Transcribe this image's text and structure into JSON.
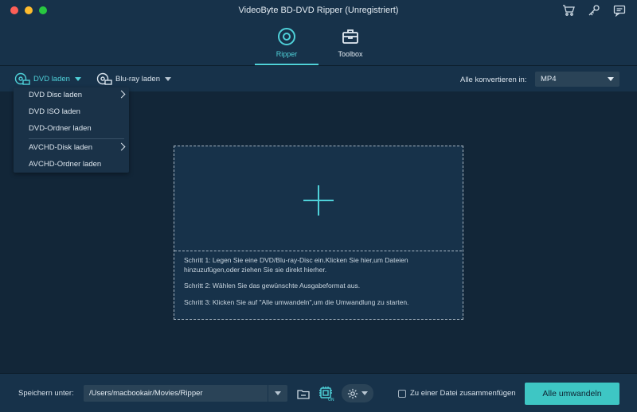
{
  "window": {
    "title": "VideoByte BD-DVD Ripper (Unregistriert)",
    "top_icons": [
      "cart-icon",
      "key-icon",
      "chat-icon"
    ]
  },
  "tabs": [
    {
      "label": "Ripper",
      "icon": "disc-icon",
      "active": true
    },
    {
      "label": "Toolbox",
      "icon": "toolbox-icon",
      "active": false
    }
  ],
  "toolbar": {
    "dvd_label": "DVD laden",
    "bluray_label": "Blu-ray laden",
    "convert_all_to_label": "Alle konvertieren in:",
    "format_value": "MP4"
  },
  "dvd_menu": {
    "items": [
      {
        "label": "DVD Disc laden",
        "submenu": true
      },
      {
        "label": "DVD ISO laden",
        "submenu": false
      },
      {
        "label": "DVD-Ordner laden",
        "submenu": false
      },
      {
        "label": "AVCHD-Disk laden",
        "submenu": true
      },
      {
        "label": "AVCHD-Ordner laden",
        "submenu": false
      }
    ]
  },
  "dropzone": {
    "step1": "Schritt 1: Legen Sie eine DVD/Blu-ray-Disc ein.Klicken Sie hier,um Dateien hinzuzufügen,oder ziehen Sie sie direkt hierher.",
    "step2": "Schritt 2: Wählen Sie das gewünschte Ausgabeformat aus.",
    "step3": "Schritt 3: Klicken Sie auf \"Alle umwandeln\",um die Umwandlung zu starten."
  },
  "bottom": {
    "save_label": "Speichern unter:",
    "path_value": "/Users/macbookair/Movies/Ripper",
    "accel_badge": "ON",
    "merge_label": "Zu einer Datei zusammenfügen",
    "merge_checked": false,
    "convert_label": "Alle umwandeln"
  },
  "colors": {
    "accent": "#4fd1d9",
    "button": "#3ec6c4",
    "background": "#122638",
    "panel": "#17324a"
  }
}
